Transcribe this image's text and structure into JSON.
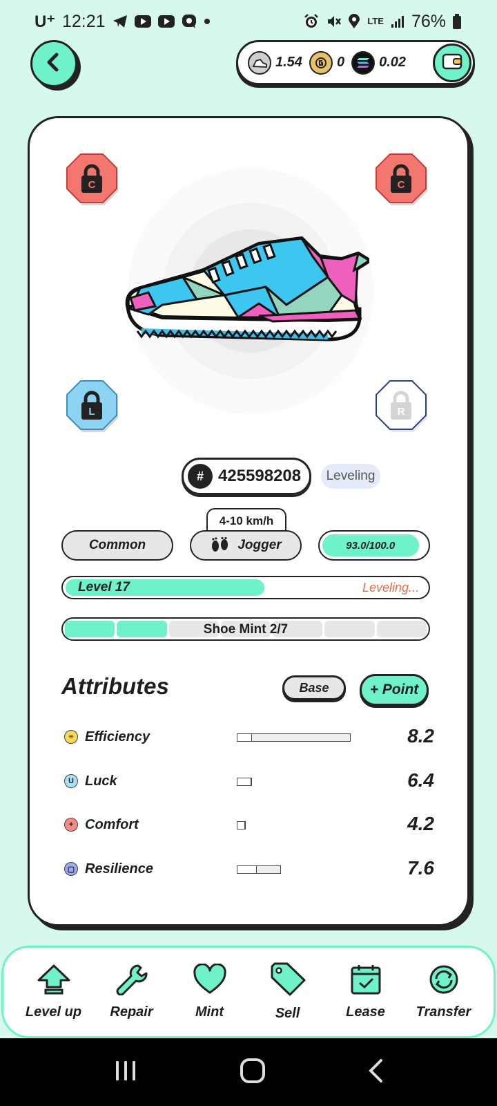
{
  "status_bar": {
    "carrier": "U⁺",
    "time": "12:21",
    "lte": "LTE",
    "battery": "76%"
  },
  "header": {
    "balances": [
      {
        "icon": "gst-coin-icon",
        "value": "1.54",
        "color": "#cfcfcf"
      },
      {
        "icon": "gmt-coin-icon",
        "value": "0",
        "color": "#e6c36a"
      },
      {
        "icon": "sol-coin-icon",
        "value": "0.02",
        "color": "#111111"
      }
    ]
  },
  "sneaker": {
    "sockets": [
      {
        "name": "socket-top-left",
        "letter": "C",
        "color": "#f4776f",
        "locked": true
      },
      {
        "name": "socket-top-right",
        "letter": "C",
        "color": "#f4776f",
        "locked": true
      },
      {
        "name": "socket-bottom-left",
        "letter": "L",
        "color": "#8dd3f2",
        "locked": true
      },
      {
        "name": "socket-bottom-right",
        "letter": "R",
        "color": "#ffffff",
        "locked": true
      }
    ],
    "id_prefix": "#",
    "id_number": "425598208",
    "status_badge": "Leveling",
    "speed_range": "4-10 km/h",
    "rarity": "Common",
    "type": "Jogger",
    "durability": "93.0/100.0",
    "durability_fraction": 0.93,
    "level_label": "Level 17",
    "level_fraction": 0.55,
    "level_status": "Leveling...",
    "mint_label": "Shoe Mint 2/7",
    "mint_count": 2,
    "mint_total": 7
  },
  "attributes": {
    "title": "Attributes",
    "base_label": "Base",
    "point_label": "+ Point",
    "items": [
      {
        "name": "Efficiency",
        "value": "8.2",
        "icon_glyph": "≡",
        "icon_color": "#f6d95a",
        "track_fraction": 0.75,
        "fill_fraction": 0.13
      },
      {
        "name": "Luck",
        "value": "6.4",
        "icon_glyph": "U",
        "icon_color": "#a7e2f7",
        "track_fraction": 0.1,
        "fill_fraction": 1.0
      },
      {
        "name": "Comfort",
        "value": "4.2",
        "icon_glyph": "+",
        "icon_color": "#f48b86",
        "track_fraction": 0.06,
        "fill_fraction": 1.0
      },
      {
        "name": "Resilience",
        "value": "7.6",
        "icon_glyph": "▢",
        "icon_color": "#9aa8ef",
        "track_fraction": 0.29,
        "fill_fraction": 0.45
      }
    ]
  },
  "actions": [
    {
      "label": "Level up",
      "icon": "level-up-icon"
    },
    {
      "label": "Repair",
      "icon": "wrench-icon"
    },
    {
      "label": "Mint",
      "icon": "heart-icon"
    },
    {
      "label": "Sell",
      "icon": "tag-icon"
    },
    {
      "label": "Lease",
      "icon": "calendar-icon"
    },
    {
      "label": "Transfer",
      "icon": "transfer-icon"
    }
  ],
  "colors": {
    "accent": "#6ff2c9",
    "background": "#d7f8ec",
    "leveling_text": "#e66a45"
  }
}
